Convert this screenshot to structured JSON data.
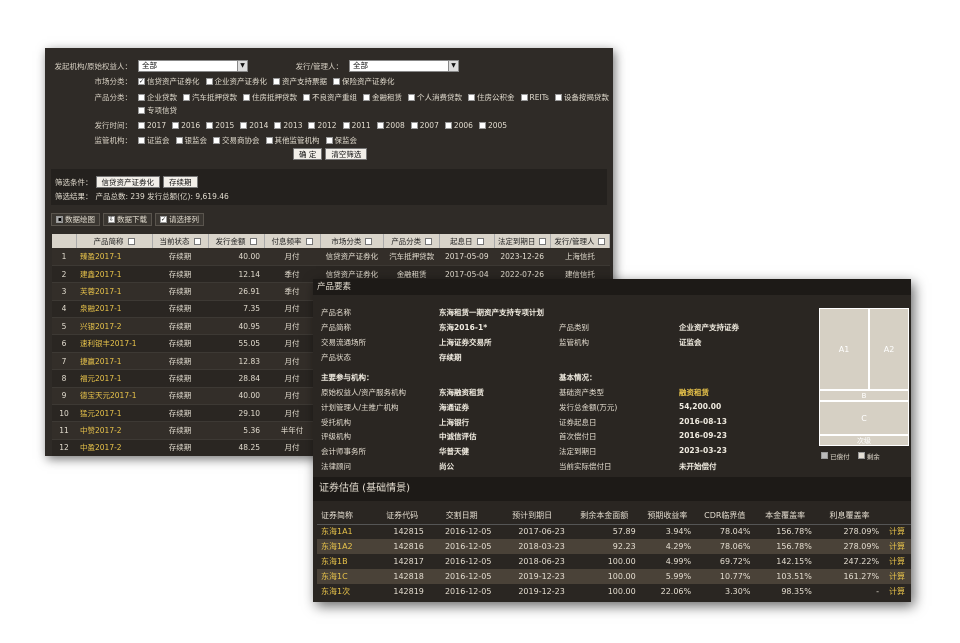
{
  "filters": {
    "issuer_label": "发起机构/原始权益人：",
    "issuer_value": "全部",
    "manager_label": "发行/管理人：",
    "manager_value": "全部",
    "market_label": "市场分类：",
    "market_options": [
      {
        "label": "信贷资产证券化",
        "checked": true
      },
      {
        "label": "企业资产证券化",
        "checked": false
      },
      {
        "label": "资产支持票据",
        "checked": false
      },
      {
        "label": "保险资产证券化",
        "checked": false
      }
    ],
    "product_label": "产品分类：",
    "product_options_row1": [
      "企业贷款",
      "汽车抵押贷款",
      "住房抵押贷款",
      "不良资产重组",
      "金融租赁",
      "个人消费贷款",
      "住房公积金",
      "REITs",
      "设备按揭贷款"
    ],
    "product_options_row2": [
      "专项信贷"
    ],
    "year_label": "发行时间：",
    "year_options": [
      "2017",
      "2016",
      "2015",
      "2014",
      "2013",
      "2012",
      "2011",
      "2008",
      "2007",
      "2006",
      "2005"
    ],
    "regulator_label": "监管机构：",
    "regulator_options": [
      "证监会",
      "银监会",
      "交易商协会",
      "其他监管机构",
      "保监会"
    ],
    "confirm_label": "确  定",
    "clear_label": "清空筛选"
  },
  "filter_result": {
    "condition_label": "筛选条件：",
    "tags": [
      "信贷资产证券化",
      "存续期"
    ],
    "result_label": "筛选结果：",
    "result_text": "产品总数: 239   发行总额(亿): 9,619.46"
  },
  "toolbar": {
    "chart_label": "数据绘图",
    "download_label": "数据下载",
    "columns_label": "请选择列"
  },
  "list_table": {
    "headers": [
      "产品简称",
      "当前状态",
      "发行金额",
      "付息频率",
      "市场分类",
      "产品分类",
      "起息日",
      "法定到期日",
      "发行/管理人"
    ],
    "rows": [
      {
        "no": "1",
        "name": "臻盈2017-1",
        "status": "存续期",
        "amount": "40.00",
        "freq": "月付",
        "market": "信贷资产证券化",
        "product": "汽车抵押贷款",
        "start": "2017-05-09",
        "due": "2023-12-26",
        "mgr": "上海信托"
      },
      {
        "no": "2",
        "name": "建鑫2017-1",
        "status": "存续期",
        "amount": "12.14",
        "freq": "季付",
        "market": "信贷资产证券化",
        "product": "金融租赁",
        "start": "2017-05-04",
        "due": "2022-07-26",
        "mgr": "建信信托"
      },
      {
        "no": "3",
        "name": "芙蓉2017-1",
        "status": "存续期",
        "amount": "26.91",
        "freq": "季付",
        "market": "",
        "product": "",
        "start": "",
        "due": "",
        "mgr": ""
      },
      {
        "no": "4",
        "name": "泉融2017-1",
        "status": "存续期",
        "amount": "7.35",
        "freq": "月付",
        "market": "",
        "product": "",
        "start": "",
        "due": "",
        "mgr": ""
      },
      {
        "no": "5",
        "name": "兴银2017-2",
        "status": "存续期",
        "amount": "40.95",
        "freq": "月付",
        "market": "",
        "product": "",
        "start": "",
        "due": "",
        "mgr": ""
      },
      {
        "no": "6",
        "name": "速利银丰2017-1",
        "status": "存续期",
        "amount": "55.05",
        "freq": "月付",
        "market": "",
        "product": "",
        "start": "",
        "due": "",
        "mgr": ""
      },
      {
        "no": "7",
        "name": "捷赢2017-1",
        "status": "存续期",
        "amount": "12.83",
        "freq": "月付",
        "market": "",
        "product": "",
        "start": "",
        "due": "",
        "mgr": ""
      },
      {
        "no": "8",
        "name": "福元2017-1",
        "status": "存续期",
        "amount": "28.84",
        "freq": "月付",
        "market": "",
        "product": "",
        "start": "",
        "due": "",
        "mgr": ""
      },
      {
        "no": "9",
        "name": "德宝天元2017-1",
        "status": "存续期",
        "amount": "40.00",
        "freq": "月付",
        "market": "",
        "product": "",
        "start": "",
        "due": "",
        "mgr": ""
      },
      {
        "no": "10",
        "name": "猛元2017-1",
        "status": "存续期",
        "amount": "29.10",
        "freq": "月付",
        "market": "",
        "product": "",
        "start": "",
        "due": "",
        "mgr": ""
      },
      {
        "no": "11",
        "name": "中赞2017-2",
        "status": "存续期",
        "amount": "5.36",
        "freq": "半年付",
        "market": "",
        "product": "",
        "start": "",
        "due": "",
        "mgr": ""
      },
      {
        "no": "12",
        "name": "中盈2017-2",
        "status": "存续期",
        "amount": "48.25",
        "freq": "月付",
        "market": "",
        "product": "",
        "start": "",
        "due": "",
        "mgr": ""
      }
    ]
  },
  "detail": {
    "title": "产品要素",
    "basic": [
      {
        "label": "产品名称",
        "value": "东海租赁一期资产支持专项计划"
      },
      {
        "label": "产品简称",
        "value": "东海2016-1*"
      },
      {
        "label": "交易流通场所",
        "value": "上海证券交易所"
      },
      {
        "label": "产品状态",
        "value": "存续期"
      }
    ],
    "basic_right": [
      {
        "label": "产品类别",
        "value": "企业资产支持证券"
      },
      {
        "label": "监管机构",
        "value": "证监会"
      }
    ],
    "participants_title": "主要参与机构：",
    "participants": [
      {
        "label": "原始权益人/资产服务机构",
        "value": "东海融资租赁"
      },
      {
        "label": "计划管理人/主推广机构",
        "value": "海通证券"
      },
      {
        "label": "受托机构",
        "value": "上海银行"
      },
      {
        "label": "评级机构",
        "value": "中诚信评估"
      },
      {
        "label": "会计师事务所",
        "value": "华普天健"
      },
      {
        "label": "法律顾问",
        "value": "尚公"
      }
    ],
    "basic_info_title": "基本情况：",
    "basic_info": [
      {
        "label": "基础资产类型",
        "value": "融资租赁",
        "highlight": true
      },
      {
        "label": "发行总金额(万元)",
        "value": "54,200.00",
        "highlight": false
      },
      {
        "label": "证券起息日",
        "value": "2016-08-13",
        "highlight": false
      },
      {
        "label": "首次偿付日",
        "value": "2016-09-23",
        "highlight": false
      },
      {
        "label": "法定到期日",
        "value": "2023-03-23",
        "highlight": false
      },
      {
        "label": "当前实际偿付日",
        "value": "未开始偿付",
        "highlight": false
      }
    ],
    "treemap_labels": [
      "A1",
      "A2",
      "B",
      "C",
      "次级"
    ],
    "legend": [
      "已偿付",
      "剩余"
    ]
  },
  "valuation": {
    "title": "证券估值 (基础情景)",
    "headers": [
      "证券简称",
      "证券代码",
      "交割日期",
      "预计到期日",
      "剩余本金面额",
      "预期收益率",
      "CDR临界值",
      "本金覆盖率",
      "利息覆盖率",
      ""
    ],
    "calc_label": "计算",
    "rows": [
      {
        "name": "东海1A1",
        "code": "142815",
        "settle": "2016-12-05",
        "due": "2017-06-23",
        "principal": "57.89",
        "yield": "3.94%",
        "cdr": "78.04%",
        "pcov": "156.78%",
        "icov": "278.09%"
      },
      {
        "name": "东海1A2",
        "code": "142816",
        "settle": "2016-12-05",
        "due": "2018-03-23",
        "principal": "92.23",
        "yield": "4.29%",
        "cdr": "78.06%",
        "pcov": "156.78%",
        "icov": "278.09%"
      },
      {
        "name": "东海1B",
        "code": "142817",
        "settle": "2016-12-05",
        "due": "2018-06-23",
        "principal": "100.00",
        "yield": "4.99%",
        "cdr": "69.72%",
        "pcov": "142.15%",
        "icov": "247.22%"
      },
      {
        "name": "东海1C",
        "code": "142818",
        "settle": "2016-12-05",
        "due": "2019-12-23",
        "principal": "100.00",
        "yield": "5.99%",
        "cdr": "10.77%",
        "pcov": "103.51%",
        "icov": "161.27%"
      },
      {
        "name": "东海1次",
        "code": "142819",
        "settle": "2016-12-05",
        "due": "2019-12-23",
        "principal": "100.00",
        "yield": "22.06%",
        "cdr": "3.30%",
        "pcov": "98.35%",
        "icov": "-"
      }
    ]
  }
}
